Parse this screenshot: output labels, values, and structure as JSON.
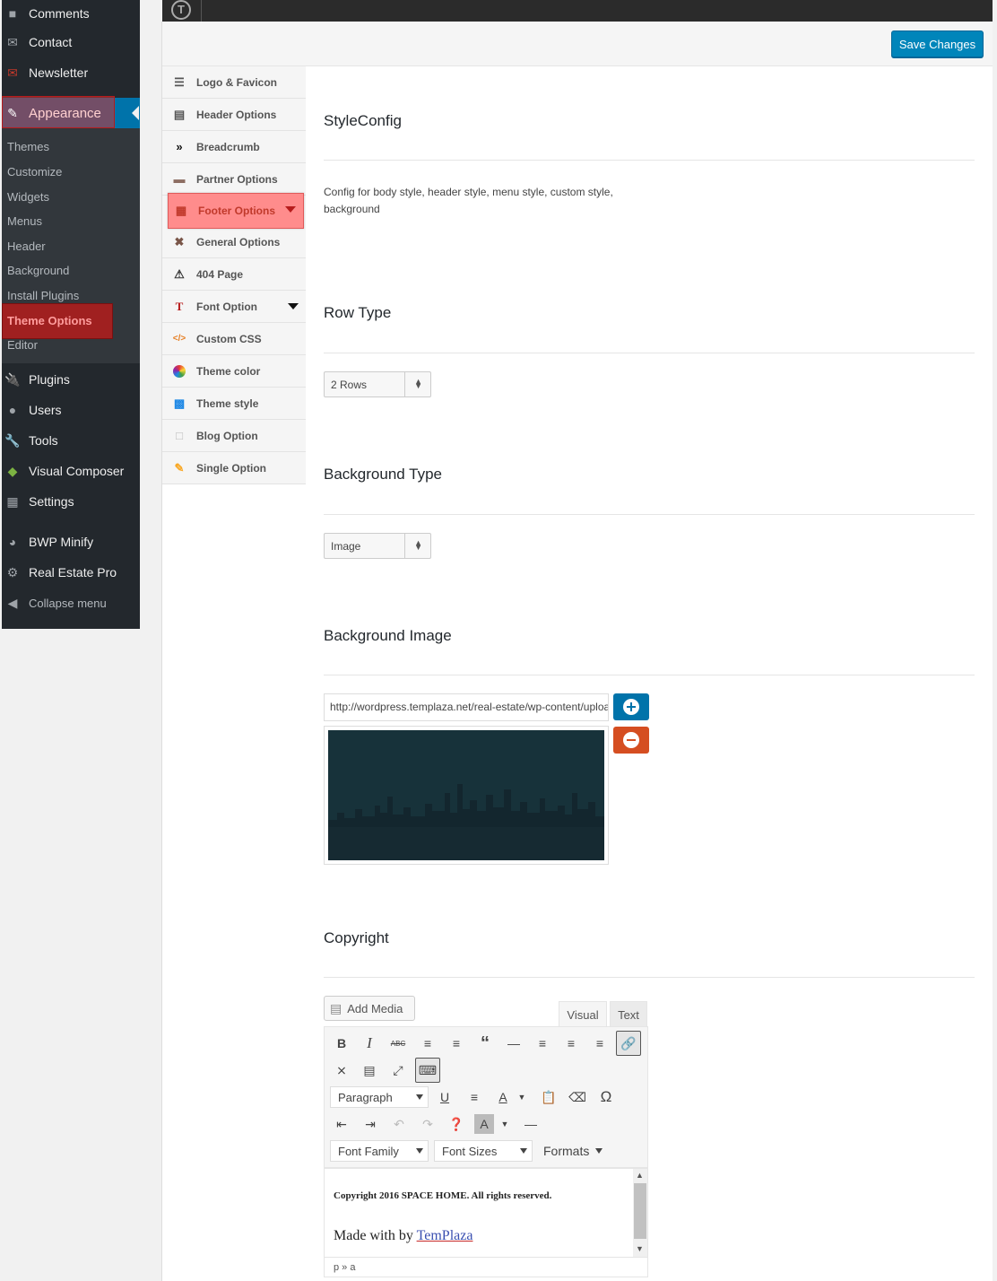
{
  "sidebar": {
    "items_top": [
      {
        "label": "Comments",
        "icon": "comments-icon"
      },
      {
        "label": "Contact",
        "icon": "mail-icon"
      },
      {
        "label": "Newsletter",
        "icon": "newsletter-icon"
      }
    ],
    "appearance": {
      "label": "Appearance",
      "icon": "paintbrush-icon"
    },
    "appearance_sub": [
      "Themes",
      "Customize",
      "Widgets",
      "Menus",
      "Header",
      "Background",
      "Install Plugins",
      "Theme Options",
      "Editor"
    ],
    "items_bottom": [
      {
        "label": "Plugins",
        "icon": "plugins-icon"
      },
      {
        "label": "Users",
        "icon": "users-icon"
      },
      {
        "label": "Tools",
        "icon": "tools-icon"
      },
      {
        "label": "Visual Composer",
        "icon": "visual-composer-icon"
      },
      {
        "label": "Settings",
        "icon": "settings-icon"
      },
      {
        "label": "BWP Minify",
        "icon": "dashboard-icon"
      },
      {
        "label": "Real Estate Pro",
        "icon": "gear-icon"
      },
      {
        "label": "Collapse menu",
        "icon": "collapse-icon"
      }
    ]
  },
  "topbar": {
    "logo_letter": "T"
  },
  "header": {
    "save_label": "Save Changes"
  },
  "option_tabs": [
    {
      "label": "Logo & Favicon",
      "icon": "menu-lines-icon"
    },
    {
      "label": "Header Options",
      "icon": "header-doc-icon"
    },
    {
      "label": "Breadcrumb",
      "icon": "double-chevron-icon"
    },
    {
      "label": "Partner Options",
      "icon": "partner-icon"
    },
    {
      "label": "Footer Options",
      "icon": "footer-doc-icon",
      "active": true
    },
    {
      "label": "General Options",
      "icon": "tools-cross-icon"
    },
    {
      "label": "404 Page",
      "icon": "warning-icon"
    },
    {
      "label": "Font Option",
      "icon": "font-icon"
    },
    {
      "label": "Custom CSS",
      "icon": "css-icon"
    },
    {
      "label": "Theme color",
      "icon": "color-wheel-icon"
    },
    {
      "label": "Theme style",
      "icon": "theme-style-icon"
    },
    {
      "label": "Blog Option",
      "icon": "blank-page-icon"
    },
    {
      "label": "Single Option",
      "icon": "edit-page-icon"
    }
  ],
  "sections": {
    "style": {
      "title": "StyleConfig",
      "desc": "Config for body style, header style, menu style, custom style, background"
    },
    "row_type": {
      "title": "Row Type",
      "value": "2 Rows"
    },
    "bg_type": {
      "title": "Background Type",
      "value": "Image"
    },
    "bg_image": {
      "title": "Background Image",
      "url": "http://wordpress.templaza.net/real-estate/wp-content/uploads/"
    },
    "copyright": {
      "title": "Copyright"
    }
  },
  "editor": {
    "add_media": "Add Media",
    "tab_visual": "Visual",
    "tab_text": "Text",
    "paragraph": "Paragraph",
    "font_family": "Font Family",
    "font_sizes": "Font Sizes",
    "formats": "Formats",
    "content_line1": "Copyright 2016 SPACE HOME. All rights reserved.",
    "content_line2_prefix": "Made with by ",
    "content_link": "TemPlaza",
    "status_path": "p » a"
  },
  "colors": {
    "accent": "#0073aa",
    "sidebar": "#23282d",
    "highlight": "#ff8c8c",
    "danger": "#d54e21"
  }
}
